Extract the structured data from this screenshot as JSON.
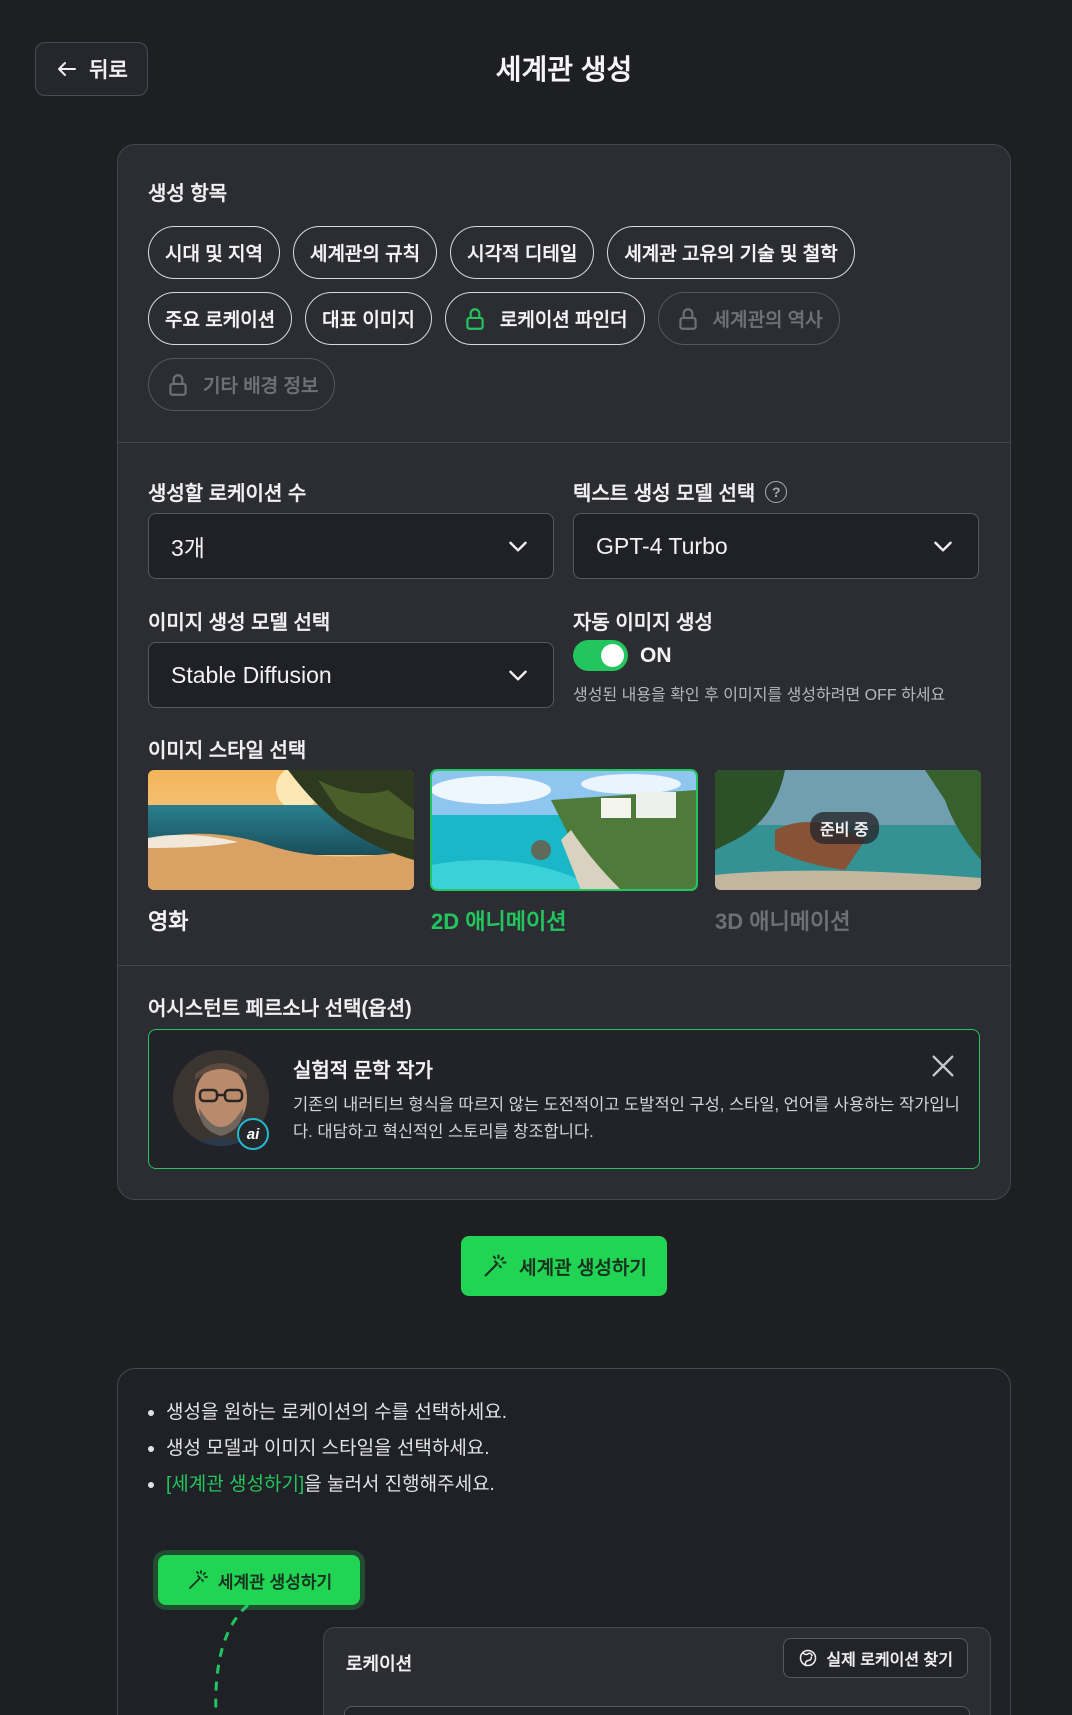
{
  "header": {
    "back_label": "뒤로",
    "title": "세계관 생성"
  },
  "generation_items": {
    "label": "생성 항목",
    "chips": [
      {
        "label": "시대 및 지역",
        "state": "active"
      },
      {
        "label": "세계관의 규칙",
        "state": "active"
      },
      {
        "label": "시각적 디테일",
        "state": "active"
      },
      {
        "label": "세계관 고유의 기술 및 철학",
        "state": "active"
      },
      {
        "label": "주요 로케이션",
        "state": "active"
      },
      {
        "label": "대표 이미지",
        "state": "active"
      },
      {
        "label": "로케이션 파인더",
        "state": "locked-active"
      },
      {
        "label": "세계관의 역사",
        "state": "disabled"
      },
      {
        "label": "기타 배경 정보",
        "state": "disabled"
      }
    ]
  },
  "settings": {
    "location_count_label": "생성할 로케이션 수",
    "location_count_value": "3개",
    "text_model_label": "텍스트 생성 모델 선택",
    "text_model_value": "GPT-4 Turbo",
    "image_model_label": "이미지 생성 모델 선택",
    "image_model_value": "Stable Diffusion",
    "auto_image_label": "자동 이미지 생성",
    "auto_image_state": "ON",
    "auto_image_hint": "생성된 내용을 확인 후 이미지를 생성하려면 OFF 하세요"
  },
  "image_style": {
    "label": "이미지 스타일 선택",
    "options": [
      {
        "name": "영화",
        "state": "normal"
      },
      {
        "name": "2D 애니메이션",
        "state": "selected"
      },
      {
        "name": "3D 애니메이션",
        "state": "disabled",
        "badge": "준비 중"
      }
    ]
  },
  "persona": {
    "label": "어시스턴트 페르소나 선택(옵션)",
    "name": "실험적 문학 작가",
    "description": "기존의 내러티브 형식을 따르지 않는 도전적이고 도발적인 구성, 스타일, 언어를 사용하는 작가입니다. 대담하고 혁신적인 스토리를 창조합니다.",
    "avatar_badge": "ai"
  },
  "generate_button": "세계관 생성하기",
  "guide": {
    "items": [
      {
        "pre": "",
        "hl": "",
        "post": "생성을 원하는 로케이션의 수를 선택하세요."
      },
      {
        "pre": "",
        "hl": "",
        "post": "생성 모델과 이미지 스타일을 선택하세요."
      },
      {
        "pre": "",
        "hl": "[세계관 생성하기]",
        "post": "을 눌러서 진행해주세요."
      }
    ],
    "mini_button": "세계관 생성하기",
    "location_title": "로케이션",
    "find_button": "실제 로케이션 찾기"
  },
  "colors": {
    "accent": "#22c55e",
    "background": "#1e1f23",
    "card": "#2c2d32"
  }
}
